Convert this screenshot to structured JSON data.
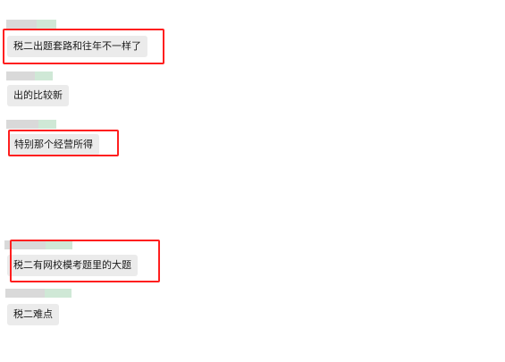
{
  "messages": [
    {
      "text": "税二出题套路和往年不一样了",
      "highlighted": true
    },
    {
      "text": "出的比较新",
      "highlighted": false
    },
    {
      "text": "特别那个经营所得",
      "highlighted": true
    },
    {
      "text": "税二有网校模考题里的大题",
      "highlighted": true
    },
    {
      "text": "税二难点",
      "highlighted": false
    }
  ],
  "colors": {
    "bubble": "#ebebeb",
    "highlight": "#ff1f1f",
    "sender_blur_gray": "#d9d9d9",
    "sender_blur_green": "#cfe8d6"
  }
}
